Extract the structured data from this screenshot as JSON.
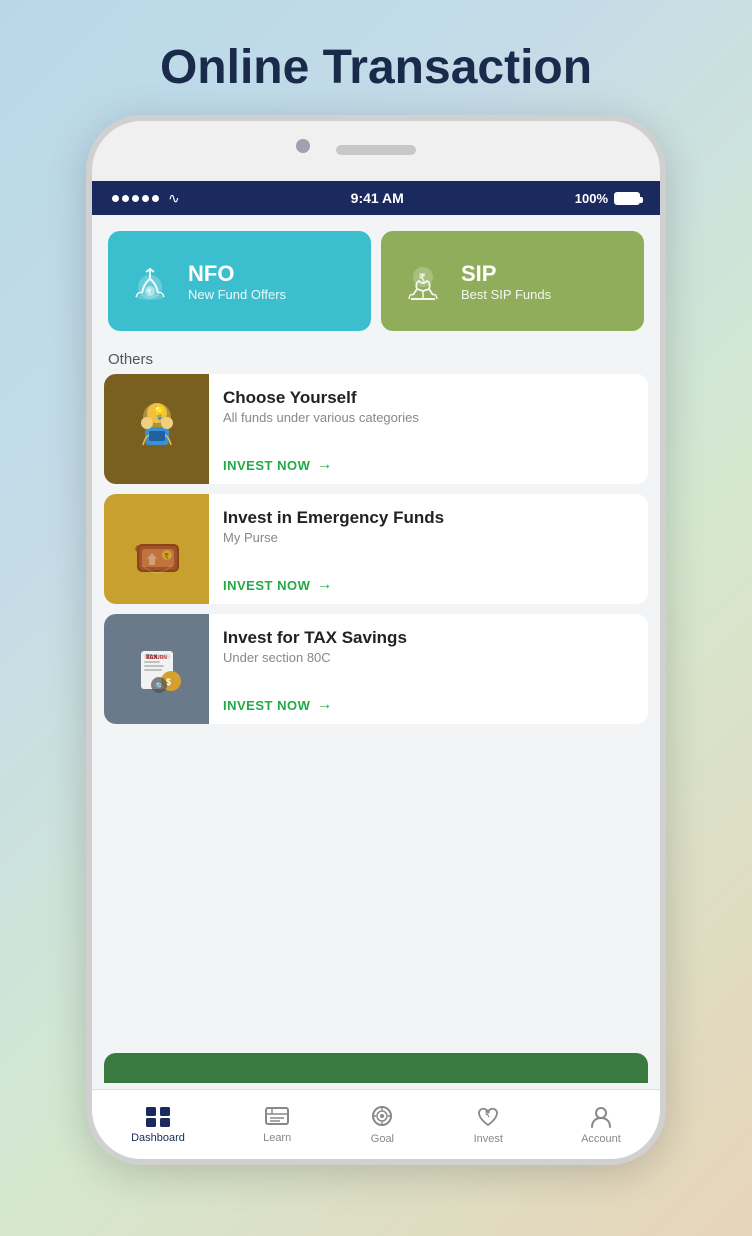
{
  "page": {
    "title": "Online Transaction"
  },
  "status_bar": {
    "time": "9:41 AM",
    "battery": "100%"
  },
  "top_cards": [
    {
      "id": "nfo",
      "title": "NFO",
      "subtitle": "New Fund Offers",
      "bg": "#3bbfce"
    },
    {
      "id": "sip",
      "title": "SIP",
      "subtitle": "Best SIP Funds",
      "bg": "#8fad5a"
    }
  ],
  "others_label": "Others",
  "list_items": [
    {
      "id": "choose-yourself",
      "title": "Choose Yourself",
      "subtitle": "All funds under various categories",
      "cta": "INVEST NOW"
    },
    {
      "id": "emergency-funds",
      "title": "Invest in Emergency Funds",
      "subtitle": "My Purse",
      "cta": "INVEST NOW"
    },
    {
      "id": "tax-savings",
      "title": "Invest for TAX Savings",
      "subtitle": "Under section 80C",
      "cta": "INVEST NOW"
    }
  ],
  "bottom_nav": [
    {
      "id": "dashboard",
      "label": "Dashboard",
      "active": true
    },
    {
      "id": "learn",
      "label": "Learn",
      "active": false
    },
    {
      "id": "goal",
      "label": "Goal",
      "active": false
    },
    {
      "id": "invest",
      "label": "Invest",
      "active": false
    },
    {
      "id": "account",
      "label": "Account",
      "active": false
    }
  ]
}
